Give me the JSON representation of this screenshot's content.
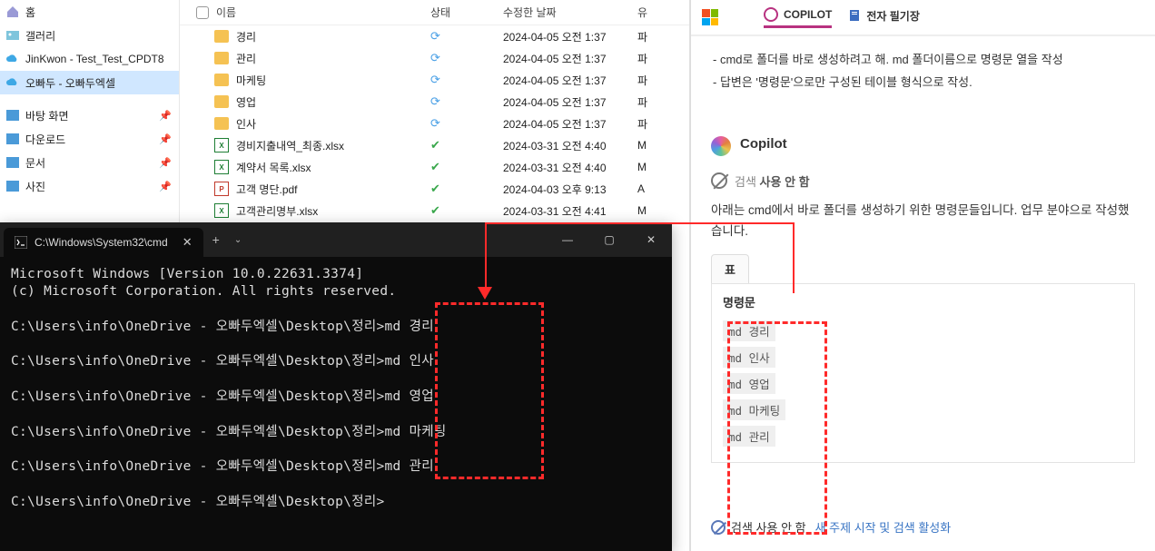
{
  "explorer": {
    "nav": [
      {
        "icon": "home",
        "label": "홈"
      },
      {
        "icon": "gallery",
        "label": "갤러리"
      },
      {
        "icon": "cloud",
        "label": "JinKwon - Test_Test_CPDT8"
      },
      {
        "icon": "onedrive",
        "label": "오빠두 - 오빠두엑셀",
        "sel": true
      }
    ],
    "nav2": [
      {
        "icon": "blue",
        "label": "바탕 화면",
        "pin": true
      },
      {
        "icon": "blue",
        "label": "다운로드",
        "pin": true
      },
      {
        "icon": "blue",
        "label": "문서",
        "pin": true
      },
      {
        "icon": "blue",
        "label": "사진",
        "pin": true
      }
    ],
    "headers": {
      "name": "이름",
      "state": "상태",
      "date": "수정한 날짜",
      "type": "유"
    },
    "files": [
      {
        "icon": "folder",
        "name": "경리",
        "state": "sync",
        "date": "2024-04-05 오전 1:37",
        "type": "파"
      },
      {
        "icon": "folder",
        "name": "관리",
        "state": "sync",
        "date": "2024-04-05 오전 1:37",
        "type": "파"
      },
      {
        "icon": "folder",
        "name": "마케팅",
        "state": "sync",
        "date": "2024-04-05 오전 1:37",
        "type": "파"
      },
      {
        "icon": "folder",
        "name": "영업",
        "state": "sync",
        "date": "2024-04-05 오전 1:37",
        "type": "파"
      },
      {
        "icon": "folder",
        "name": "인사",
        "state": "sync",
        "date": "2024-04-05 오전 1:37",
        "type": "파"
      },
      {
        "icon": "excel",
        "name": "경비지출내역_최종.xlsx",
        "state": "ok",
        "date": "2024-03-31 오전 4:40",
        "type": "M"
      },
      {
        "icon": "excel",
        "name": "계약서 목록.xlsx",
        "state": "ok",
        "date": "2024-03-31 오전 4:40",
        "type": "M"
      },
      {
        "icon": "pdf",
        "name": "고객 명단.pdf",
        "state": "ok",
        "date": "2024-04-03 오후 9:13",
        "type": "A"
      },
      {
        "icon": "excel",
        "name": "고객관리명부.xlsx",
        "state": "ok",
        "date": "2024-03-31 오전 4:41",
        "type": "M"
      }
    ]
  },
  "terminal": {
    "tab_title": "C:\\Windows\\System32\\cmd",
    "banner1": "Microsoft Windows [Version 10.0.22631.3374]",
    "banner2": "(c) Microsoft Corporation. All rights reserved.",
    "prompt_path": "C:\\Users\\info\\OneDrive - 오빠두엑셀\\Desktop\\정리",
    "cmds": [
      "md 경리",
      "md 인사",
      "md 영업",
      "md 마케팅",
      "md 관리"
    ]
  },
  "copilot": {
    "tab1": "COPILOT",
    "tab2": "전자 필기장",
    "bullets": [
      "- cmd로 폴더를 바로 생성하려고 해. md 폴더이름으로 명령문 열을 작성",
      "- 답변은 '명령문'으로만 구성된 테이블 형식으로 작성."
    ],
    "name": "Copilot",
    "meta": "검색 사용 안 함",
    "answer": "아래는 cmd에서 바로 폴더를 생성하기 위한 명령문들입니다. 업무 분야으로 작성했습니다.",
    "table_tab": "표",
    "table_head": "명령문",
    "table_rows": [
      "md 경리",
      "md 인사",
      "md 영업",
      "md 마케팅",
      "md 관리"
    ],
    "footer1": "검색 사용 안 함",
    "footer2": "새 주제 시작 및 검색 활성화"
  }
}
